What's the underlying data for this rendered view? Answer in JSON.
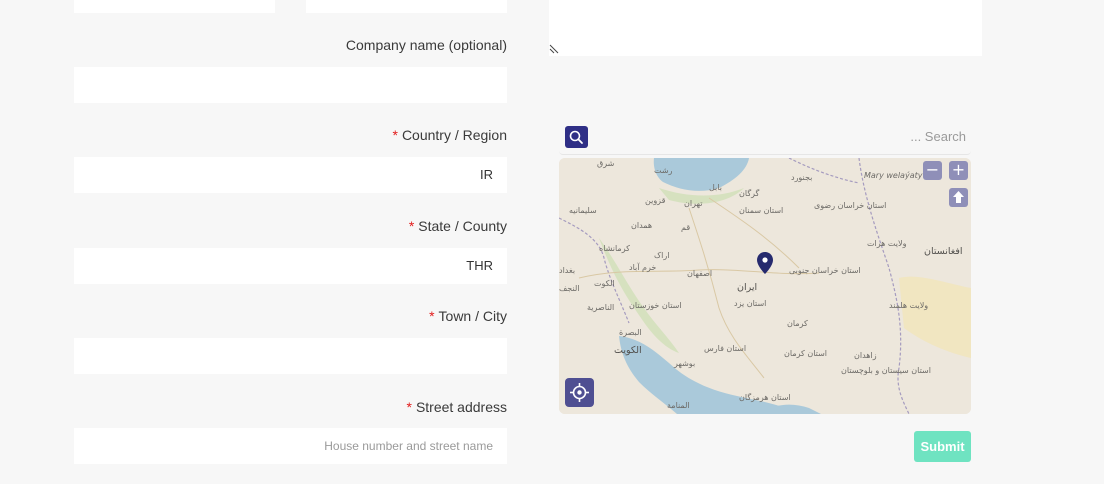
{
  "form": {
    "company": {
      "label": "Company name (optional)",
      "value": ""
    },
    "country": {
      "required_mark": "*",
      "label": "Country / Region",
      "value": "IR"
    },
    "state": {
      "required_mark": "*",
      "label": "State / County",
      "value": "THR"
    },
    "city": {
      "required_mark": "*",
      "label": "Town / City",
      "value": ""
    },
    "street": {
      "required_mark": "*",
      "label": "Street address",
      "placeholder": "House number and street name"
    }
  },
  "map": {
    "search_placeholder": "... Search",
    "zoom_in": "+",
    "zoom_out": "−",
    "labels": [
      "شرق",
      "رشت",
      "بابل",
      "گرگان",
      "بجنورد",
      "Mary welaýaty",
      "سلیمانیه",
      "قزوین",
      "تهران",
      "استان سمنان",
      "استان خراسان رضوی",
      "کرمانشاه",
      "همدان",
      "قم",
      "اراک",
      "ولایت هرات",
      "افغانستان",
      "بغداد",
      "خرم آباد",
      "اصفهان",
      "استان خراسان جنوبی",
      "الکوت",
      "ایران",
      "استان یزد",
      "النجف",
      "الناصریة",
      "استان خوزستان",
      "البصرة",
      "کرمان",
      "الکویت",
      "استان فارس",
      "استان کرمان",
      "زاهدان",
      "بوشهر",
      "استان سیستان و بلوچستان",
      "ولایت هلمند",
      "المنامة",
      "استان هرمزگان"
    ],
    "colors": {
      "water": "#aac9da",
      "land": "#ede7dc",
      "pin": "#262a6e",
      "search_btn": "#2f2f86"
    }
  },
  "submit": {
    "label": "Submit",
    "color": "#6fe3c1"
  }
}
